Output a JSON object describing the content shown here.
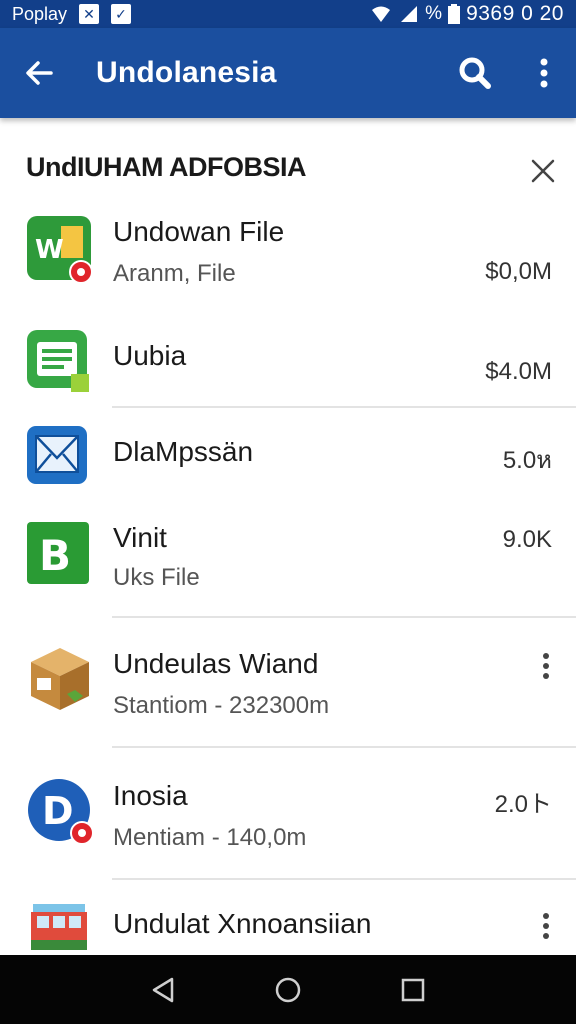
{
  "status_bar": {
    "carrier": "Poplay",
    "battery_text": "%",
    "time": "9369 0 20"
  },
  "app_bar": {
    "title": "Undolanesia"
  },
  "sheet": {
    "title": "UndIUHAM ADFOBSIA"
  },
  "items": [
    {
      "title": "Undowan File",
      "subtitle": "Aranm, File",
      "size": "$0,0M",
      "icon": "spreadsheet-app-icon"
    },
    {
      "title": "Uubia",
      "subtitle": "",
      "size": "$4.0M",
      "icon": "notes-app-icon"
    },
    {
      "title": "DlaMpssän",
      "subtitle": "",
      "size": "5.0ห",
      "icon": "mail-app-icon"
    },
    {
      "title": "Vinit",
      "subtitle": "Uks File",
      "size": "9.0K",
      "icon": "green-b-app-icon"
    },
    {
      "title": "Undeulas Wiand",
      "subtitle": "Stantiom - 232300m",
      "size": "",
      "icon": "package-box-icon"
    },
    {
      "title": "Inosia",
      "subtitle": "Mentiam - 140,0m",
      "size": "2.0ト",
      "icon": "blue-d-app-icon"
    },
    {
      "title": "Undulat Xnnoansiian",
      "subtitle": "",
      "size": "",
      "icon": "tram-app-icon"
    }
  ],
  "colors": {
    "status_bar": "#123f8a",
    "app_bar": "#1b4f9f",
    "nav_bar": "#050505",
    "divider": "#e3e3e3"
  }
}
